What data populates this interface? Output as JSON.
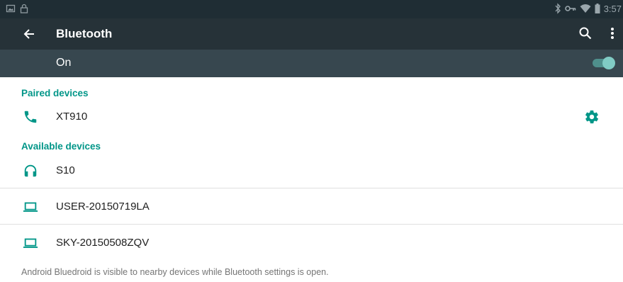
{
  "status_bar": {
    "time": "3:57",
    "left_icons": [
      "image-icon",
      "lock-icon"
    ],
    "right_icons": [
      "bluetooth-icon",
      "vpn-key-icon",
      "wifi-icon",
      "battery-icon"
    ]
  },
  "toolbar": {
    "title": "Bluetooth",
    "back_icon": "arrow-left-icon",
    "search_icon": "search-icon",
    "menu_icon": "more-vert-icon"
  },
  "bluetooth_switch": {
    "label": "On",
    "state": "on"
  },
  "paired_section": {
    "header": "Paired devices",
    "devices": [
      {
        "name": "XT910",
        "icon": "phone-icon",
        "settings_icon": "gear-icon"
      }
    ]
  },
  "available_section": {
    "header": "Available devices",
    "devices": [
      {
        "name": "S10",
        "icon": "headset-icon"
      },
      {
        "name": "USER-20150719LA",
        "icon": "laptop-icon"
      },
      {
        "name": "SKY-20150508ZQV",
        "icon": "laptop-icon"
      }
    ]
  },
  "footer": {
    "note": "Android Bluedroid is visible to nearby devices while Bluetooth settings is open."
  },
  "colors": {
    "status_bar": "#1f2d34",
    "toolbar": "#263238",
    "switch_bar": "#37474f",
    "accent": "#009688",
    "toggle_thumb": "#80cbc4"
  }
}
